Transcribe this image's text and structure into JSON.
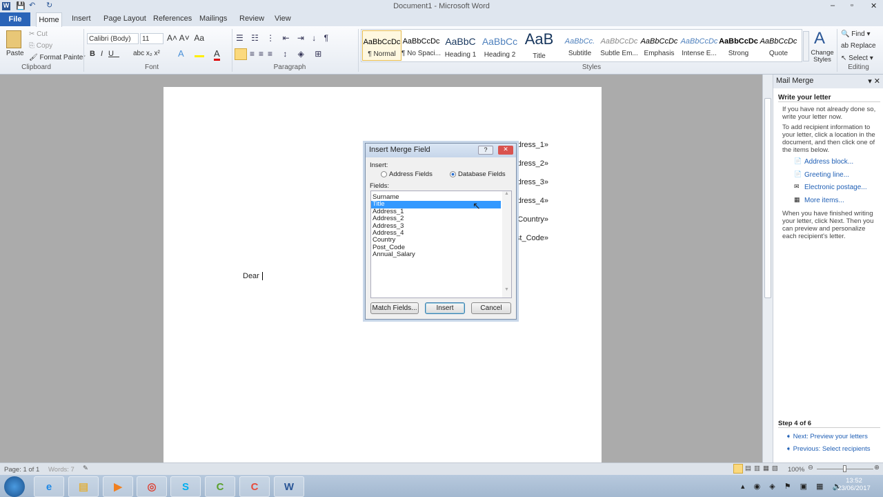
{
  "window": {
    "title": "Document1 - Microsoft Word"
  },
  "ribbon_tabs": [
    "File",
    "Home",
    "Insert",
    "Page Layout",
    "References",
    "Mailings",
    "Review",
    "View"
  ],
  "clipboard": {
    "paste": "Paste",
    "cut": "Cut",
    "copy": "Copy",
    "format_painter": "Format Painter",
    "group": "Clipboard"
  },
  "font": {
    "name": "Calibri (Body)",
    "size": "11",
    "group": "Font"
  },
  "paragraph": {
    "group": "Paragraph"
  },
  "styles": {
    "group": "Styles",
    "items": [
      {
        "preview": "AaBbCcDc",
        "label": "¶ Normal"
      },
      {
        "preview": "AaBbCcDc",
        "label": "¶ No Spaci..."
      },
      {
        "preview": "AaBbC",
        "label": "Heading 1"
      },
      {
        "preview": "AaBbCc",
        "label": "Heading 2"
      },
      {
        "preview": "AaB",
        "label": "Title"
      },
      {
        "preview": "AaBbCc.",
        "label": "Subtitle"
      },
      {
        "preview": "AaBbCcDc",
        "label": "Subtle Em..."
      },
      {
        "preview": "AaBbCcDc",
        "label": "Emphasis"
      },
      {
        "preview": "AaBbCcDc",
        "label": "Intense E..."
      },
      {
        "preview": "AaBbCcDc",
        "label": "Strong"
      },
      {
        "preview": "AaBbCcDc",
        "label": "Quote"
      }
    ],
    "change_styles": "Change Styles"
  },
  "editing": {
    "group": "Editing",
    "find": "Find",
    "replace": "Replace",
    "select": "Select"
  },
  "document": {
    "merge_fields": [
      "«Address_1»",
      "«Address_2»",
      "«Address_3»",
      "«Address_4»",
      "«Country»",
      "«Post_Code»"
    ],
    "greeting": "Dear"
  },
  "dialog": {
    "title": "Insert Merge Field",
    "insert_label": "Insert:",
    "address_fields": "Address Fields",
    "database_fields": "Database Fields",
    "selected_option": "Database Fields",
    "fields_label": "Fields:",
    "fields": [
      "Surname",
      "Title",
      "Address_1",
      "Address_2",
      "Address_3",
      "Address_4",
      "Country",
      "Post_Code",
      "Annual_Salary"
    ],
    "selected_field": "Title",
    "match_fields": "Match Fields...",
    "insert": "Insert",
    "cancel": "Cancel"
  },
  "mail_merge": {
    "title": "Mail Merge",
    "heading": "Write your letter",
    "p1": "If you have not already done so, write your letter now.",
    "p2": "To add recipient information to your letter, click a location in the document, and then click one of the items below.",
    "links": [
      "Address block...",
      "Greeting line...",
      "Electronic postage...",
      "More items..."
    ],
    "p3": "When you have finished writing your letter, click Next. Then you can preview and personalize each recipient's letter.",
    "step": "Step 4 of 6",
    "next": "Next: Preview your letters",
    "previous": "Previous: Select recipients"
  },
  "status": {
    "page": "Page: 1 of 1",
    "words": "Words: 7",
    "zoom": "100%"
  },
  "taskbar": {
    "time": "13:52",
    "date": "23/06/2017",
    "apps": [
      "internet-explorer",
      "file-explorer",
      "media-player",
      "chrome",
      "skype",
      "camtasia-recorder",
      "camtasia-studio",
      "word"
    ]
  },
  "colors": {
    "file_tab": "#2a64b8",
    "selection": "#3399ff",
    "link": "#1f5fb5"
  }
}
